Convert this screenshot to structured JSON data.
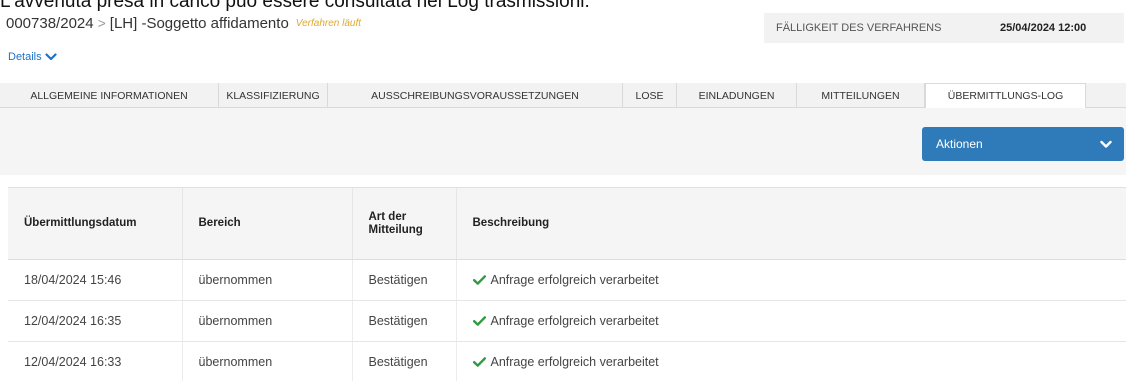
{
  "caption": "L'avvenuta presa in carico può essere consultata nel Log trasmissioni:",
  "header": {
    "procedure_id": "000738/2024",
    "separator": ">",
    "procedure_title": "[LH] -Soggetto affidamento",
    "status": "Verfahren läuft",
    "deadline_label": "FÄLLIGKEIT DES VERFAHRENS",
    "deadline_value": "25/04/2024 12:00",
    "details_label": "Details"
  },
  "tabs": [
    {
      "label": "ALLGEMEINE INFORMATIONEN"
    },
    {
      "label": "KLASSIFIZIERUNG"
    },
    {
      "label": "AUSSCHREIBUNGSVORAUSSETZUNGEN"
    },
    {
      "label": "LOSE"
    },
    {
      "label": "EINLADUNGEN"
    },
    {
      "label": "MITTEILUNGEN"
    },
    {
      "label": "ÜBERMITTLUNGS-LOG"
    }
  ],
  "active_tab": "ÜBERMITTLUNGS-LOG",
  "toolbar": {
    "actions_label": "Aktionen"
  },
  "table": {
    "headers": [
      "Übermittlungsdatum",
      "Bereich",
      "Art der Mitteilung",
      "Beschreibung"
    ],
    "rows": [
      {
        "date": "18/04/2024 15:46",
        "area": "übernommen",
        "type": "Bestätigen",
        "description": "Anfrage erfolgreich verarbeitet"
      },
      {
        "date": "12/04/2024 16:35",
        "area": "übernommen",
        "type": "Bestätigen",
        "description": "Anfrage erfolgreich verarbeitet"
      },
      {
        "date": "12/04/2024 16:33",
        "area": "übernommen",
        "type": "Bestätigen",
        "description": "Anfrage erfolgreich verarbeitet"
      }
    ]
  },
  "colors": {
    "accent": "#2f7ab9",
    "success": "#2e9b3e",
    "status": "#e0a82e",
    "link": "#1a73c9"
  },
  "icons": {
    "details_toggle": "chevron-down-icon",
    "actions_toggle": "chevron-down-icon",
    "row_status": "check-icon"
  }
}
